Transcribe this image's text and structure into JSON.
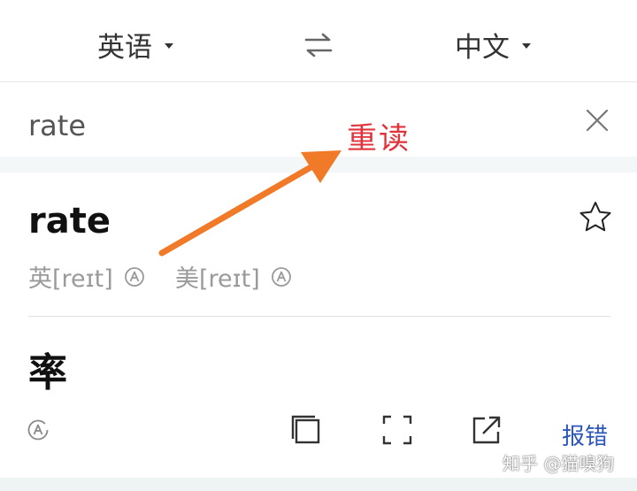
{
  "header": {
    "source_lang": "英语",
    "target_lang": "中文",
    "swap_icon": "swap-arrows-icon"
  },
  "input": {
    "query": "rate",
    "annotation": "重读",
    "clear_icon": "close-icon"
  },
  "result": {
    "headword": "rate",
    "favorite_icon": "star-outline-icon",
    "phonetic_uk": "英[reɪt]",
    "phonetic_us": "美[reɪt]",
    "audio_icon": "audio-play-icon",
    "translation": "率"
  },
  "toolbar": {
    "copy_icon": "copy-icon",
    "fullscreen_icon": "fullscreen-icon",
    "share_icon": "share-icon",
    "report_label": "报错"
  },
  "watermark": "知乎 @猫嗅狗",
  "colors": {
    "annotation": "#e0343c",
    "arrow": "#f07a28",
    "link": "#2c56b8"
  }
}
